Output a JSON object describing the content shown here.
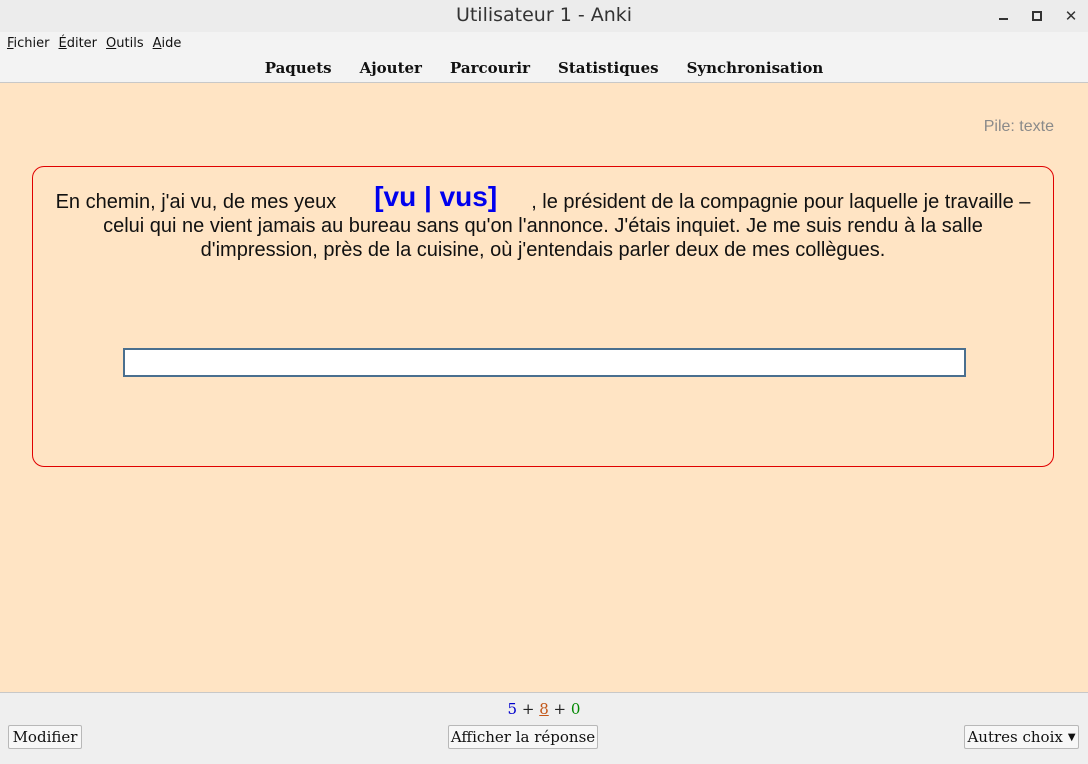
{
  "window": {
    "title": "Utilisateur 1 - Anki"
  },
  "menu": {
    "items": [
      {
        "first": "F",
        "rest": "ichier"
      },
      {
        "first": "É",
        "rest": "diter"
      },
      {
        "first": "O",
        "rest": "utils"
      },
      {
        "first": "A",
        "rest": "ide"
      }
    ]
  },
  "toolbar": {
    "decks": "Paquets",
    "add": "Ajouter",
    "browse": "Parcourir",
    "stats": "Statistiques",
    "sync": "Synchronisation"
  },
  "reviewer": {
    "deck_label": "Pile: texte",
    "card": {
      "text_before": "En chemin, j'ai vu, de mes yeux",
      "cloze": "[vu | vus]",
      "text_after": ", le président de la compagnie pour laquelle je travaille – celui qui ne vient jamais au bureau sans qu'on l'annonce. J'étais inquiet. Je me suis rendu à la salle d'impression, près de la cuisine, où j'entendais parler deux de mes collègues."
    },
    "answer_input": {
      "value": "",
      "placeholder": ""
    }
  },
  "bottom": {
    "counts": {
      "new": "5",
      "learning": "8",
      "review": "0",
      "plus": "+"
    },
    "edit_button": "Modifier",
    "show_answer_button": "Afficher la réponse",
    "more_button": "Autres choix"
  },
  "colors": {
    "card_background": "#ffe4c4",
    "card_border": "#e00000",
    "cloze": "#0000ee",
    "new_count": "#0000cc",
    "learning_count": "#c35617",
    "review_count": "#008800"
  }
}
